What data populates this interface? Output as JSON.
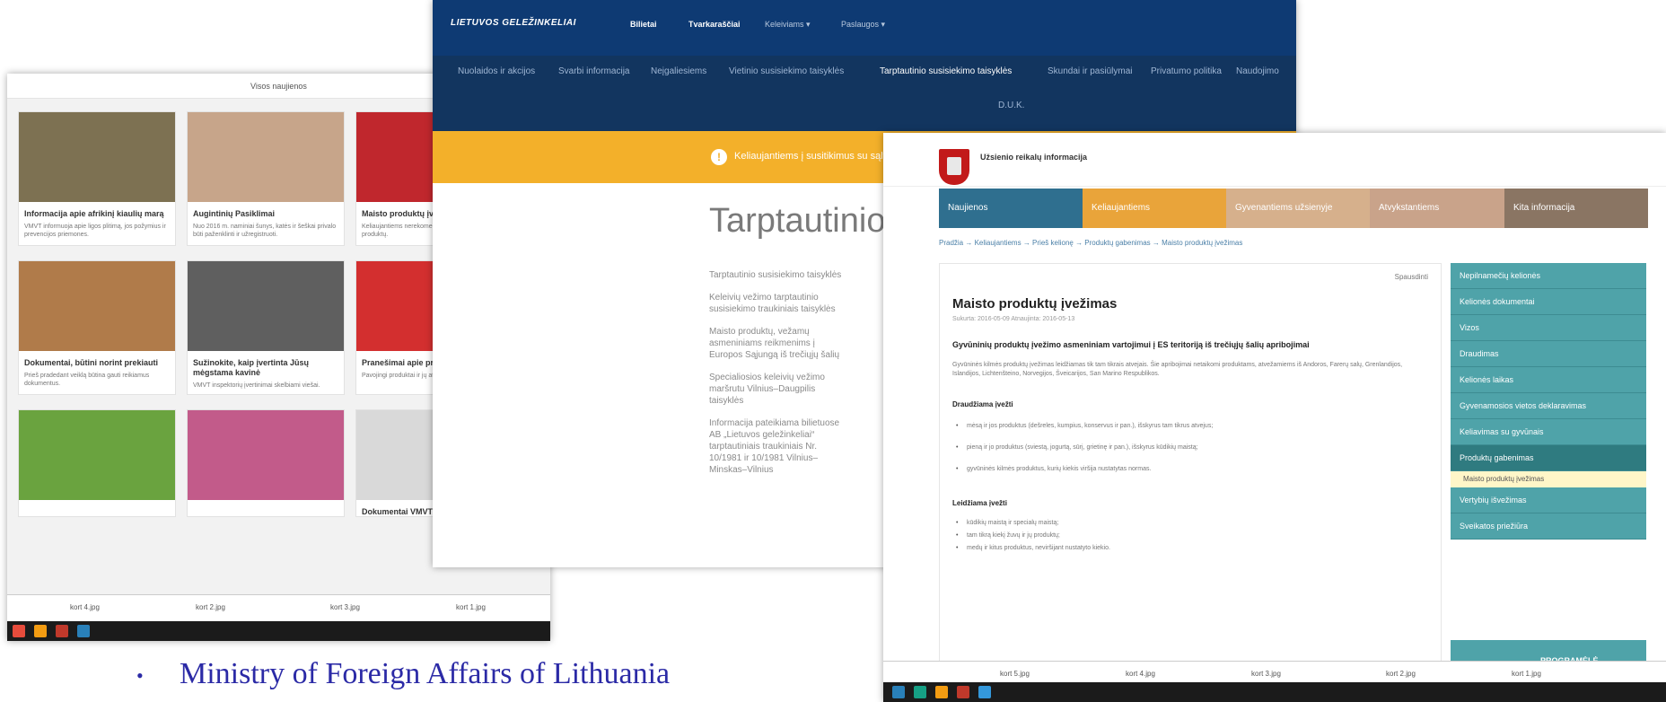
{
  "shot1": {
    "topbar": "Visos naujienos",
    "cards": [
      {
        "title": "Informacija apie afrikinį kiaulių marą",
        "text": "VMVT informuoja apie ligos plitimą, jos požymius ir prevencijos priemones.",
        "color": "#7d7152"
      },
      {
        "title": "Augintinių Pasiklimai",
        "text": "Nuo 2016 m. naminiai šunys, katės ir šeškai privalo būti paženklinti ir užregistruoti.",
        "color": "#c7a58a"
      },
      {
        "title": "Maisto produktų įvežimas",
        "text": "Keliaujantiems nerekomenduojama vežtis gyvūninių produktų.",
        "color": "#c0272d"
      },
      {
        "title": "Dokumentai, būtini norint prekiauti",
        "text": "Prieš pradedant veiklą būtina gauti reikiamus dokumentus.",
        "color": "#b07b4a"
      },
      {
        "title": "Sužinokite, kaip įvertinta Jūsų mėgstama kavinė",
        "text": "VMVT inspektorių įvertinimai skelbiami viešai.",
        "color": "#5f5f5f"
      },
      {
        "title": "Pranešimai apie produktus",
        "text": "Pavojingi produktai ir jų atšaukimas.",
        "color": "#d32f2f"
      },
      {
        "title": "",
        "text": "",
        "color": "#6aa33f"
      },
      {
        "title": "",
        "text": "",
        "color": "#c25b8a"
      },
      {
        "title": "Dokumentai VMVT paslaugos",
        "text": "",
        "color": "#d9d9d9"
      }
    ],
    "downloads": [
      "kort 4.jpg",
      "kort 2.jpg",
      "kort 3.jpg",
      "kort 1.jpg"
    ]
  },
  "shot2": {
    "logo": "LIETUVOS GELEŽINKELIAI",
    "nav": [
      "Bilietai",
      "Tvarkaraščiai",
      "Keleiviams ▾",
      "Paslaugos ▾"
    ],
    "subnav": [
      "Nuolaidos ir akcijos",
      "Svarbi informacija",
      "Neįgaliesiems",
      "Vietinio susisiekimo taisyklės",
      "Tarptautinio susisiekimo taisyklės",
      "Skundai ir pasiūlymai",
      "Privatumo politika",
      "Naudojimo"
    ],
    "duk": "D.U.K.",
    "alert": "Keliaujantiems į susitikimus su sąlyg",
    "title": "Tarptautinio s",
    "links": [
      "Tarptautinio susisiekimo taisyklės",
      "Keleivių vežimo tarptautinio susisiekimo traukiniais taisyklės",
      "Maisto produktų, vežamų asmeniniams reikmenims į Europos Sąjungą iš trečiųjų šalių",
      "Specialiosios keleivių vežimo maršrutu Vilnius–Daugpilis taisyklės",
      "Informacija pateikiama bilietuose AB „Lietuvos geležinkeliai“ tarptautiniais traukiniais Nr. 10/1981 ir 10/1981 Vilnius–Minskas–Vilnius"
    ]
  },
  "shot3": {
    "site": "Užsienio reikalų informacija",
    "nav": [
      {
        "label": "Naujienos",
        "color": "#2f6f8f"
      },
      {
        "label": "Keliaujantiems",
        "color": "#e9a43a"
      },
      {
        "label": "Gyvenantiems užsienyje",
        "color": "#d6b08c"
      },
      {
        "label": "Atvykstantiems",
        "color": "#c9a38a"
      },
      {
        "label": "Kita informacija",
        "color": "#8a7563"
      }
    ],
    "breadcrumb": "Pradžia → Keliaujantiems → Prieš kelionę → Produktų gabenimas → Maisto produktų įvežimas",
    "print": "Spausdinti",
    "title": "Maisto produktų įvežimas",
    "meta": "Sukurta: 2016-05-09 Atnaujinta: 2016-05-13",
    "subtitle": "Gyvūninių produktų įvežimo asmeniniam vartojimui į ES teritoriją iš trečiųjų šalių apribojimai",
    "intro": "Gyvūninės kilmės produktų įvežimas leidžiamas tik tam tikrais atvejais. Šie apribojimai netaikomi produktams, atvežamiems iš Andoros, Farerų salų, Grenlandijos, Islandijos, Lichtenšteino, Norvegijos, Šveicarijos, San Marino Respublikos.",
    "forbidden_title": "Draudžiama įvežti",
    "forbidden": [
      "mėsą ir jos produktus (dešreles, kumpius, konservus ir pan.), išskyrus tam tikrus atvejus;",
      "pieną ir jo produktus (sviestą, jogurtą, sūrį, grietinę ir pan.), išskyrus kūdikių maistą;",
      "gyvūninės kilmės produktus, kurių kiekis viršija nustatytas normas."
    ],
    "allowed_title": "Leidžiama įvežti",
    "allowed": [
      "kūdikių maistą ir specialų maistą;",
      "tam tikrą kiekį žuvų ir jų produktų;",
      "medų ir kitus produktus, neviršijant nustatyto kiekio."
    ],
    "sidebar": [
      "Nepilnamečių kelionės",
      "Kelionės dokumentai",
      "Vizos",
      "Draudimas",
      "Kelionės laikas",
      "Gyvenamosios vietos deklaravimas",
      "Keliavimas su gyvūnais",
      "Produktų gabenimas",
      "Vertybių išvežimas",
      "Sveikatos priežiūra"
    ],
    "sidebar_sub": "Maisto produktų įvežimas",
    "banner": "PROGRAMĖLĖ",
    "downloads": [
      "kort 5.jpg",
      "kort 4.jpg",
      "kort 3.jpg",
      "kort 2.jpg",
      "kort 1.jpg"
    ]
  },
  "caption": "Ministry of Foreign Affairs of Lithuania",
  "accent": "#2b2aa6"
}
